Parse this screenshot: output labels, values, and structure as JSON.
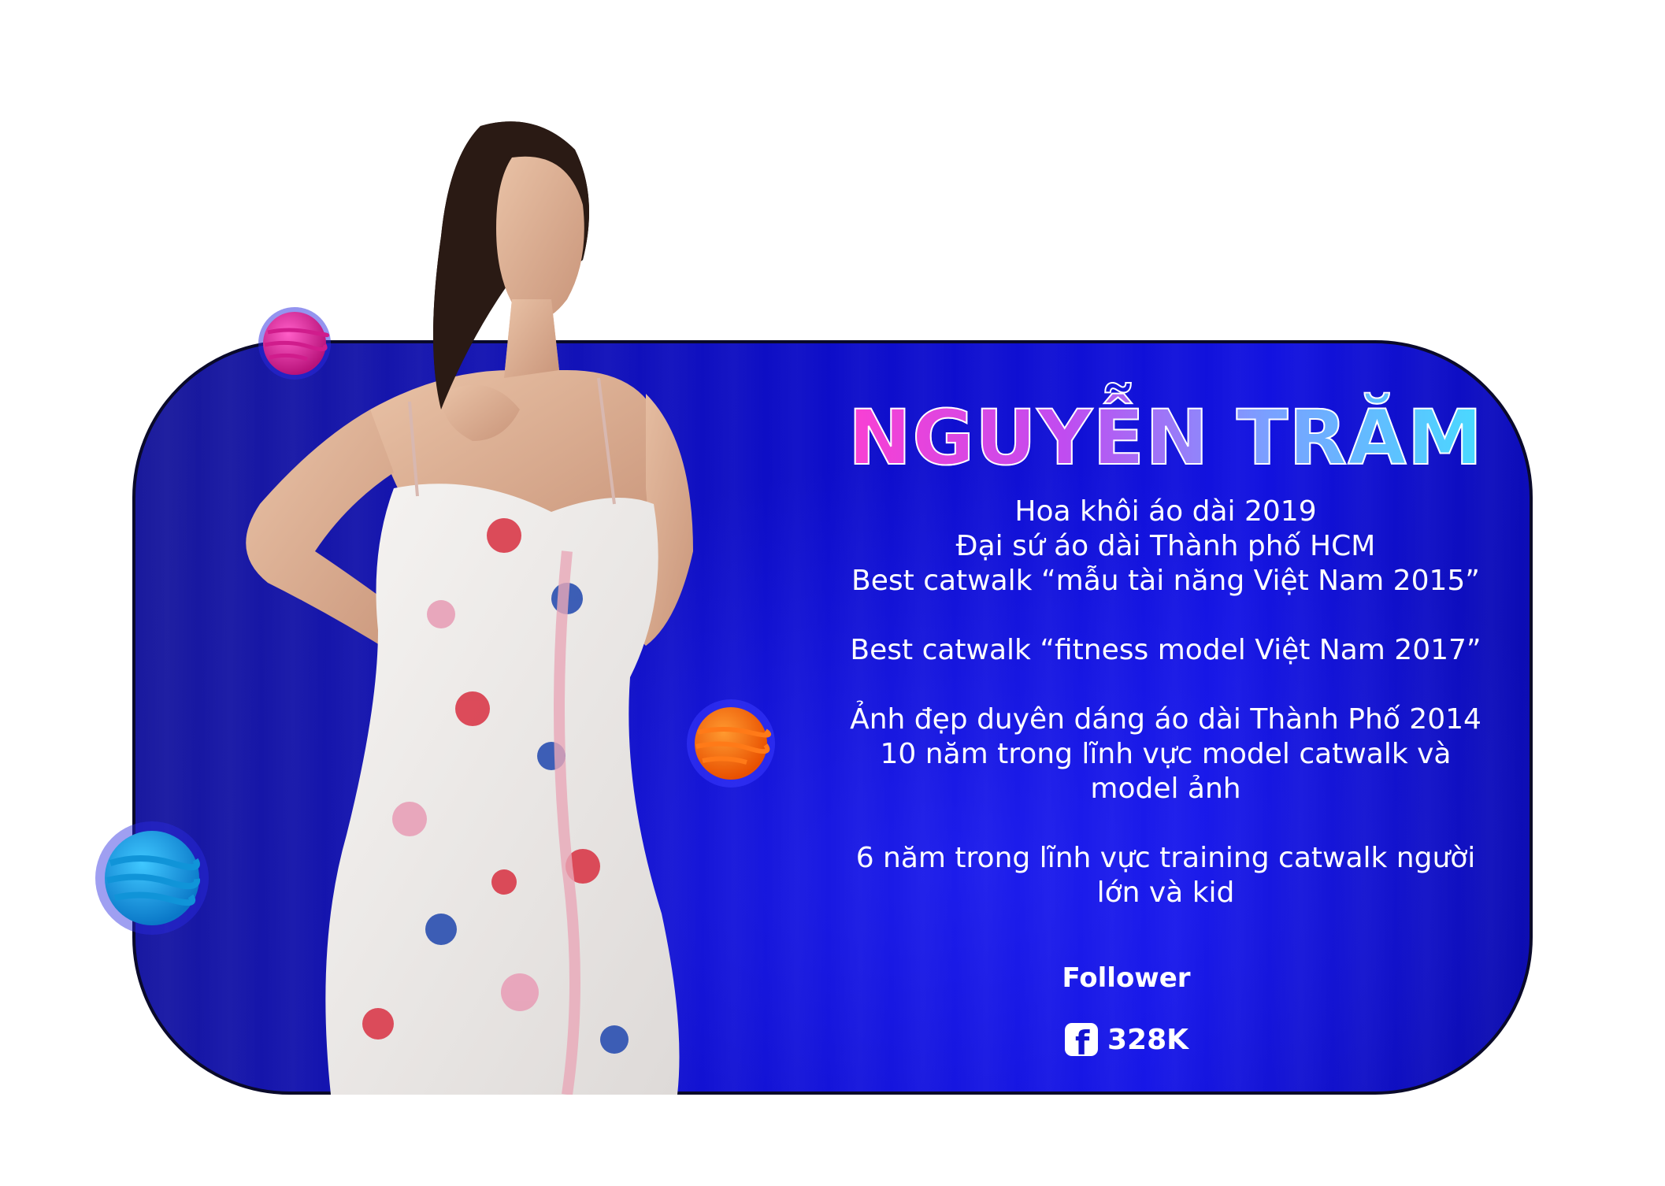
{
  "profile": {
    "name": "NGUYỄN TRĂM",
    "bio": [
      "Hoa khôi áo dài 2019",
      "Đại sứ áo dài Thành phố HCM",
      "Best catwalk “mẫu tài năng Việt Nam 2015”",
      "",
      "Best catwalk “fitness model Việt Nam 2017”",
      "",
      "Ảnh đẹp duyên dáng áo dài Thành Phố 2014",
      "10 năm trong lĩnh vực model catwalk và",
      "model ảnh",
      "",
      "6 năm trong lĩnh vực training catwalk người",
      "lớn và kid"
    ]
  },
  "followers": {
    "label": "Follower",
    "icon": "facebook-icon",
    "count": "328K"
  },
  "colors": {
    "card_background": "#1010d0",
    "name_gradient": [
      "#ff3fd0",
      "#7aa0ff",
      "#44e0ff"
    ],
    "planet_pink": "#e0249a",
    "planet_orange": "#ff6a10",
    "planet_blue": "#1aa6e0"
  }
}
